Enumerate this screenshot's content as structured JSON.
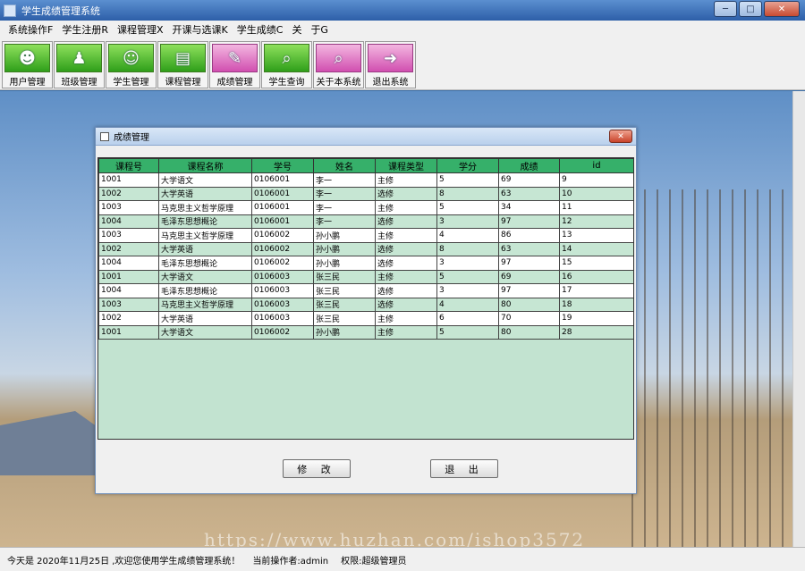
{
  "window": {
    "title": "学生成绩管理系统",
    "min": "─",
    "max": "□",
    "close": "✕"
  },
  "menu": [
    "系统操作F",
    "学生注册R",
    "课程管理X",
    "开课与选课K",
    "学生成绩C",
    "关",
    "于G"
  ],
  "toolbar": [
    {
      "label": "用户管理",
      "icon": "users-icon",
      "glyph": "☻"
    },
    {
      "label": "班级管理",
      "icon": "class-icon",
      "glyph": "♟"
    },
    {
      "label": "学生管理",
      "icon": "student-icon",
      "glyph": "☺"
    },
    {
      "label": "课程管理",
      "icon": "course-icon",
      "glyph": "▤"
    },
    {
      "label": "成绩管理",
      "icon": "grade-icon",
      "glyph": "✎",
      "accent": "pink"
    },
    {
      "label": "学生查询",
      "icon": "search-icon",
      "glyph": "⌕"
    },
    {
      "label": "关于本系统",
      "icon": "about-icon",
      "glyph": "⌕",
      "accent": "pink"
    },
    {
      "label": "退出系统",
      "icon": "exit-icon",
      "glyph": "➜",
      "accent": "pink"
    }
  ],
  "dialog": {
    "title": "成绩管理",
    "close": "✕",
    "columns": [
      "课程号",
      "课程名称",
      "学号",
      "姓名",
      "课程类型",
      "学分",
      "成绩",
      "id"
    ],
    "rows": [
      [
        "1001",
        "大学语文",
        "0106001",
        "李一",
        "主修",
        "5",
        "69",
        "9"
      ],
      [
        "1002",
        "大学英语",
        "0106001",
        "李一",
        "选修",
        "8",
        "63",
        "10"
      ],
      [
        "1003",
        "马克思主义哲学原理",
        "0106001",
        "李一",
        "主修",
        "5",
        "34",
        "11"
      ],
      [
        "1004",
        "毛泽东思想概论",
        "0106001",
        "李一",
        "选修",
        "3",
        "97",
        "12"
      ],
      [
        "1003",
        "马克思主义哲学原理",
        "0106002",
        "孙小鹏",
        "主修",
        "4",
        "86",
        "13"
      ],
      [
        "1002",
        "大学英语",
        "0106002",
        "孙小鹏",
        "选修",
        "8",
        "63",
        "14"
      ],
      [
        "1004",
        "毛泽东思想概论",
        "0106002",
        "孙小鹏",
        "选修",
        "3",
        "97",
        "15"
      ],
      [
        "1001",
        "大学语文",
        "0106003",
        "张三民",
        "主修",
        "5",
        "69",
        "16"
      ],
      [
        "1004",
        "毛泽东思想概论",
        "0106003",
        "张三民",
        "选修",
        "3",
        "97",
        "17"
      ],
      [
        "1003",
        "马克思主义哲学原理",
        "0106003",
        "张三民",
        "选修",
        "4",
        "80",
        "18"
      ],
      [
        "1002",
        "大学英语",
        "0106003",
        "张三民",
        "主修",
        "6",
        "70",
        "19"
      ],
      [
        "1001",
        "大学语文",
        "0106002",
        "孙小鹏",
        "主修",
        "5",
        "80",
        "28"
      ]
    ],
    "modify_button": "修 改",
    "exit_button": "退 出"
  },
  "status": {
    "greeting": "今天是 2020年11月25日 ,欢迎您使用学生成绩管理系统！",
    "operator": "当前操作者:admin",
    "permission": "权限:超级管理员"
  },
  "watermark": "https://www.huzhan.com/ishop3572"
}
